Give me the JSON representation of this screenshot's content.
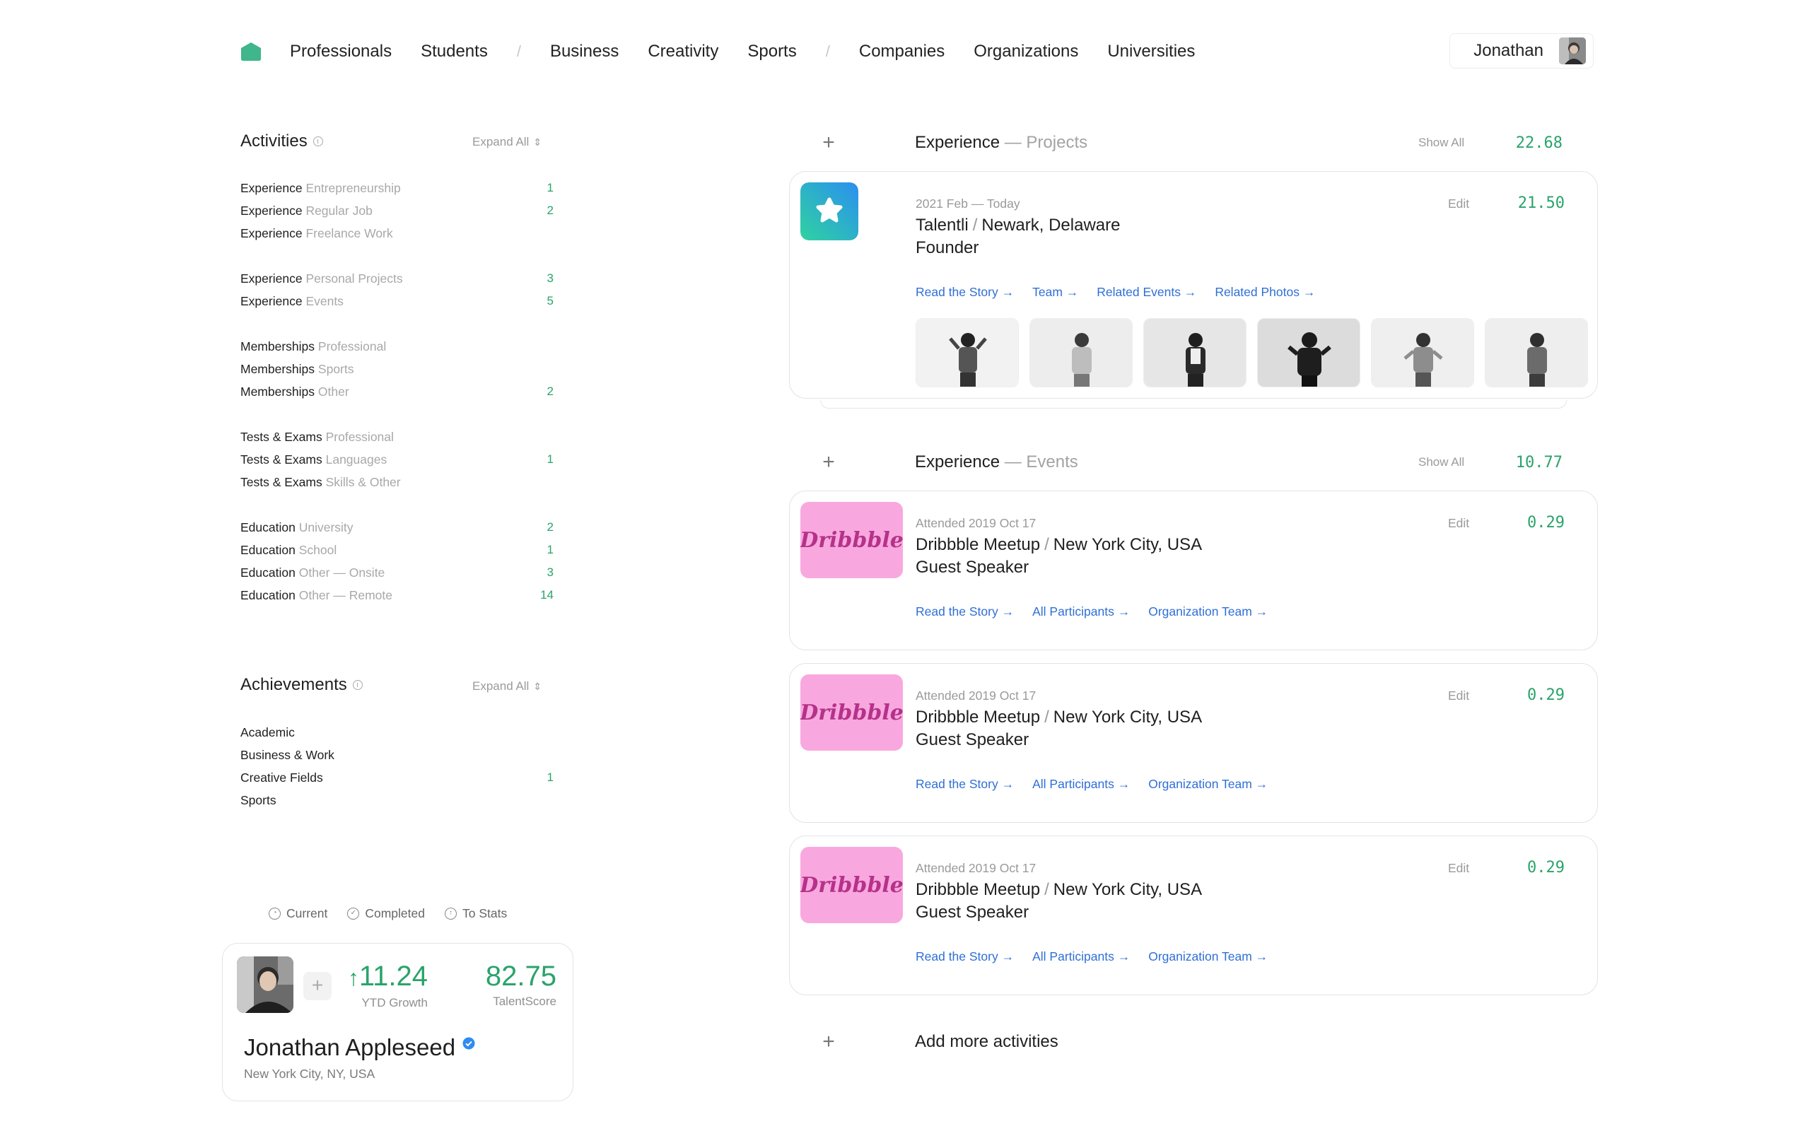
{
  "nav": {
    "items": [
      "Professionals",
      "Students",
      "Business",
      "Creativity",
      "Sports",
      "Companies",
      "Organizations",
      "Universities"
    ],
    "user_name": "Jonathan"
  },
  "activities": {
    "title": "Activities",
    "expand_label": "Expand All",
    "groups": [
      [
        {
          "key": "Experience",
          "sub": "Entrepreneurship",
          "count": "1"
        },
        {
          "key": "Experience",
          "sub": "Regular Job",
          "count": "2"
        },
        {
          "key": "Experience",
          "sub": "Freelance Work",
          "count": ""
        }
      ],
      [
        {
          "key": "Experience",
          "sub": "Personal Projects",
          "count": "3"
        },
        {
          "key": "Experience",
          "sub": "Events",
          "count": "5"
        }
      ],
      [
        {
          "key": "Memberships",
          "sub": "Professional",
          "count": ""
        },
        {
          "key": "Memberships",
          "sub": "Sports",
          "count": ""
        },
        {
          "key": "Memberships",
          "sub": "Other",
          "count": "2"
        }
      ],
      [
        {
          "key": "Tests & Exams",
          "sub": "Professional",
          "count": ""
        },
        {
          "key": "Tests & Exams",
          "sub": "Languages",
          "count": "1"
        },
        {
          "key": "Tests & Exams",
          "sub": "Skills & Other",
          "count": ""
        }
      ],
      [
        {
          "key": "Education",
          "sub": "University",
          "count": "2"
        },
        {
          "key": "Education",
          "sub": "School",
          "count": "1"
        },
        {
          "key": "Education",
          "sub": "Other — Onsite",
          "count": "3"
        },
        {
          "key": "Education",
          "sub": "Other — Remote",
          "count": "14"
        }
      ]
    ]
  },
  "achievements": {
    "title": "Achievements",
    "expand_label": "Expand All",
    "items": [
      {
        "key": "Academic",
        "count": ""
      },
      {
        "key": "Business & Work",
        "count": ""
      },
      {
        "key": "Creative Fields",
        "count": "1"
      },
      {
        "key": "Sports",
        "count": ""
      }
    ]
  },
  "legend": {
    "current": "Current",
    "completed": "Completed",
    "to_stats": "To Stats"
  },
  "profile": {
    "growth": "11.24",
    "growth_label": "YTD Growth",
    "score": "82.75",
    "score_label": "TalentScore",
    "name": "Jonathan Appleseed",
    "location": "New York City, NY, USA"
  },
  "projects_section": {
    "title": "Experience",
    "subtitle": "Projects",
    "show_all": "Show All",
    "score": "22.68",
    "card": {
      "date_start": "2021 Feb",
      "date_end": "Today",
      "company": "Talentli",
      "place": "Newark, Delaware",
      "role": "Founder",
      "edit": "Edit",
      "score": "21.50",
      "links": [
        "Read the Story →",
        "Team →",
        "Related Events →",
        "Related Photos →"
      ]
    }
  },
  "events_section": {
    "title": "Experience",
    "subtitle": "Events",
    "show_all": "Show All",
    "score": "10.77",
    "cards": [
      {
        "date": "Attended 2019 Oct 17",
        "event": "Dribbble Meetup",
        "place": "New York City, USA",
        "role": "Guest Speaker",
        "edit": "Edit",
        "score": "0.29",
        "logo": "Dribbble"
      },
      {
        "date": "Attended 2019 Oct 17",
        "event": "Dribbble Meetup",
        "place": "New York City, USA",
        "role": "Guest Speaker",
        "edit": "Edit",
        "score": "0.29",
        "logo": "Dribbble"
      },
      {
        "date": "Attended 2019 Oct 17",
        "event": "Dribbble Meetup",
        "place": "New York City, USA",
        "role": "Guest Speaker",
        "edit": "Edit",
        "score": "0.29",
        "logo": "Dribbble"
      }
    ],
    "links": [
      "Read the Story →",
      "All Participants →",
      "Organization Team →"
    ]
  },
  "add_more": "Add more activities",
  "colors": {
    "accent_green": "#2aa36b",
    "link_blue": "#2f6fd6",
    "dribbble_pink": "#f9a8df"
  }
}
